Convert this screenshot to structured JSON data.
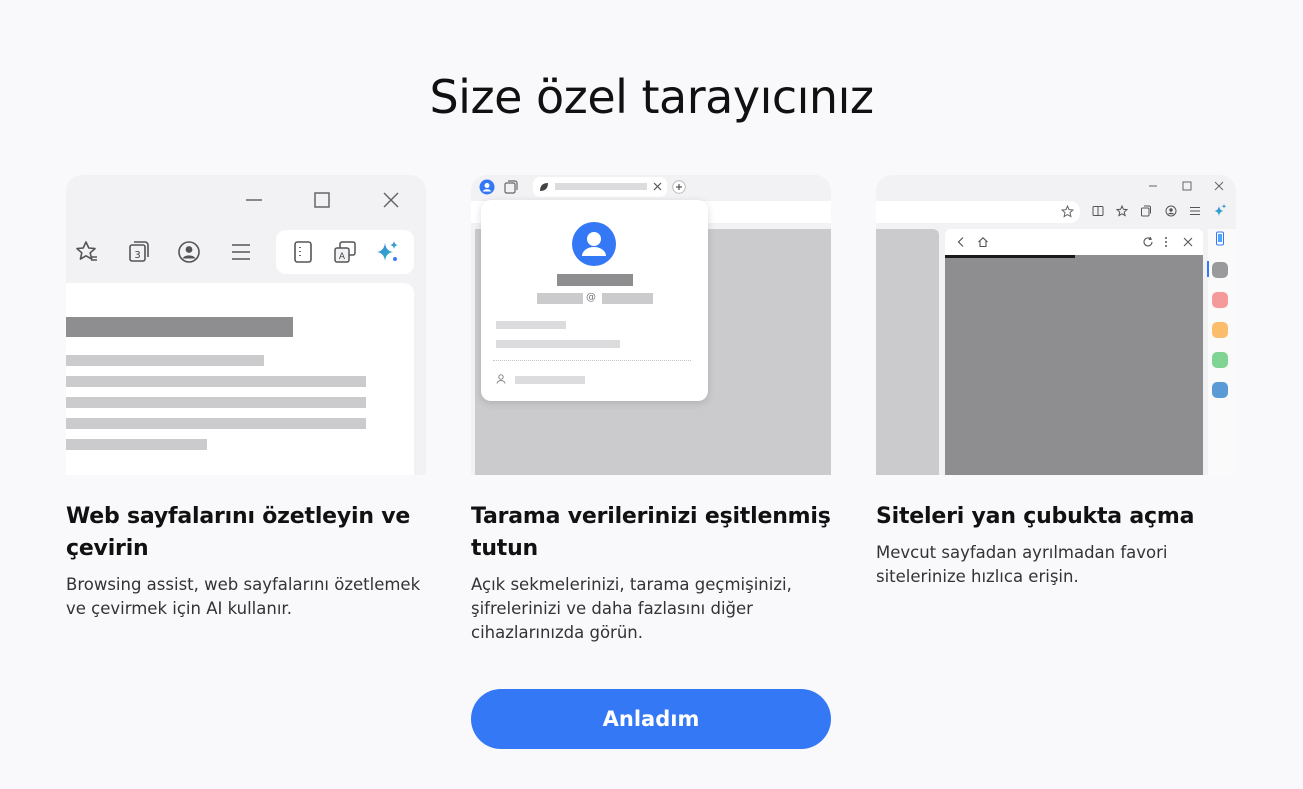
{
  "page": {
    "title": "Size özel tarayıcınız"
  },
  "cards": [
    {
      "title": "Web sayfalarını özetleyin ve çevirin",
      "description": "Browsing assist, web sayfalarını özetlemek ve çevirmek için AI kullanır.",
      "illustration": {
        "tab_count_badge": "3"
      }
    },
    {
      "title": "Tarama verilerinizi eşitlenmiş tutun",
      "description": "Açık sekmelerinizi, tarama geçmişinizi, şifrelerinizi ve daha fazlasını diğer cihazlarınızda görün.",
      "illustration": {
        "email_at": "@"
      }
    },
    {
      "title": "Siteleri yan çubukta açma",
      "description": "Mevcut sayfadan ayrılmadan favori sitelerinize hızlıca erişin.",
      "illustration": {
        "sidebar_dot_colors": [
          "#9a9a9c",
          "#f59a9a",
          "#fbbd6c",
          "#7fd494",
          "#5b9bd5"
        ]
      }
    }
  ],
  "cta": {
    "label": "Anladım"
  },
  "colors": {
    "accent": "#3478f6",
    "ai_gradient_start": "#3d7bf7",
    "ai_gradient_end": "#2bc0a8"
  }
}
